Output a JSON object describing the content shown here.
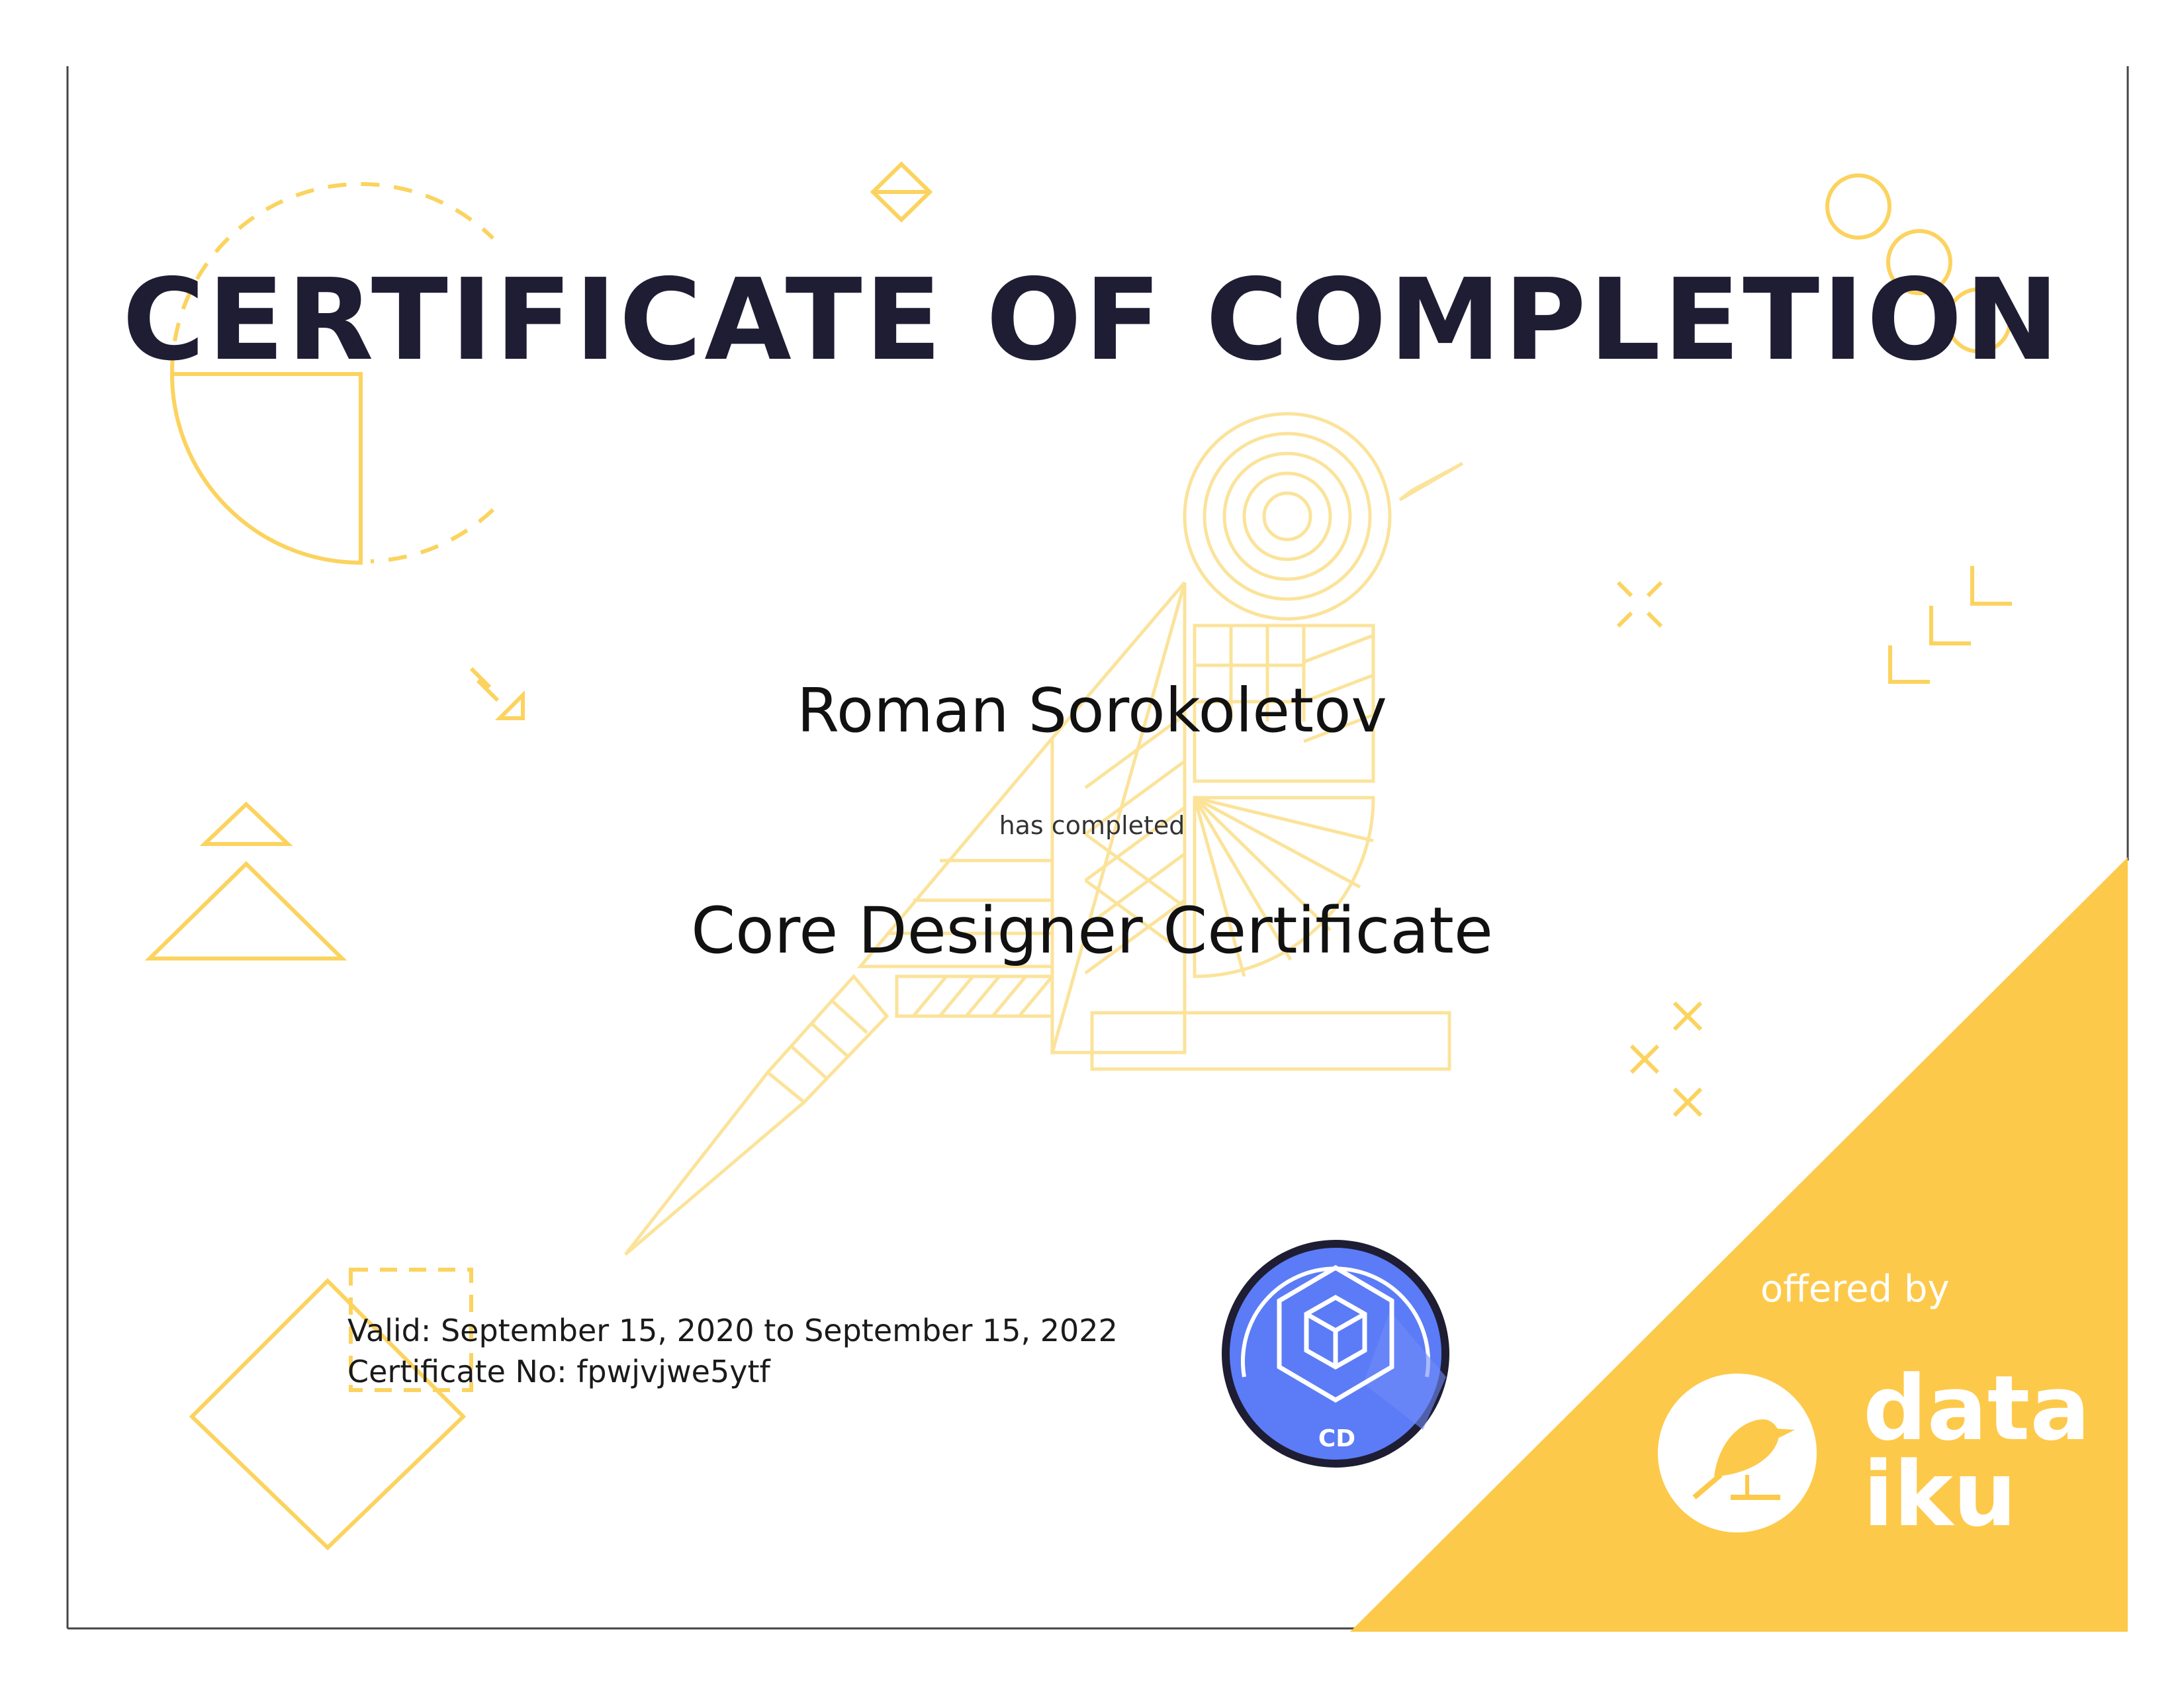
{
  "certificate": {
    "title": "CERTIFICATE OF COMPLETION",
    "recipient": "Roman Sorokoletov",
    "completion_phrase": "has completed",
    "course": "Core Designer Certificate",
    "valid_line": "Valid: September 15, 2020 to September 15, 2022",
    "certificate_no_line": "Certificate No: fpwjvjwe5ytf"
  },
  "badge": {
    "label": "CD",
    "icon": "cube-icon",
    "colors": {
      "fill": "#5b7cf6",
      "ring": "#1f1d33"
    }
  },
  "provider": {
    "offered_by": "offered by",
    "brand_line1": "data",
    "brand_line2": "iku",
    "logo_icon": "bird-icon"
  },
  "theme": {
    "accent": "#fdc94a",
    "accent_line": "#fbd35e",
    "title_color": "#1f1d33",
    "border_color": "#333333"
  }
}
